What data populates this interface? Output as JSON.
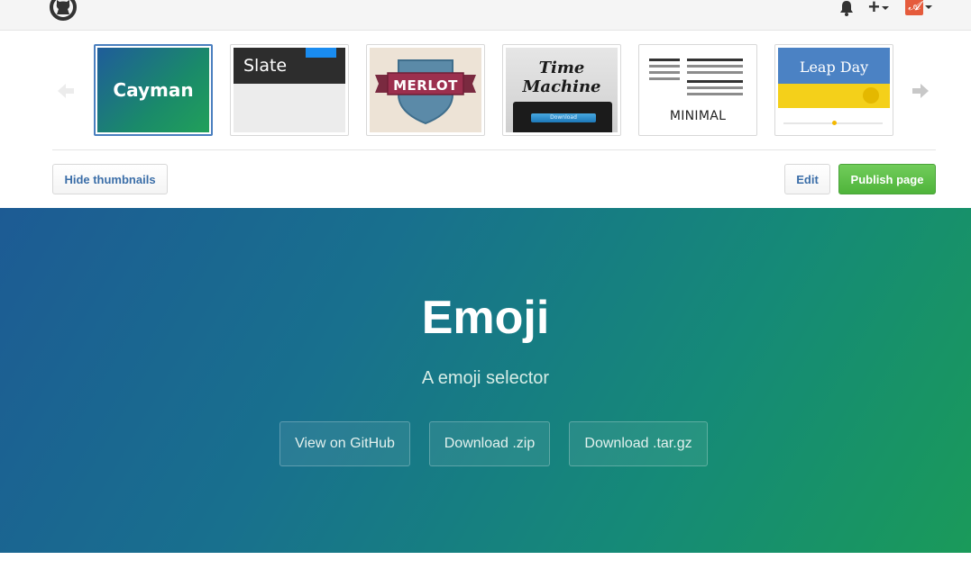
{
  "header": {
    "logo_icon": "github-octocat-icon",
    "notifications_icon": "bell-icon",
    "new_icon": "plus-icon",
    "plus_symbol": "+",
    "avatar_letter": "𝓐"
  },
  "themes": {
    "items": [
      {
        "label": "Cayman",
        "selected": true
      },
      {
        "label": "Slate",
        "selected": false
      },
      {
        "label": "MERLOT",
        "selected": false
      },
      {
        "label": "Time Machine",
        "line1": "Time",
        "line2": "Machine",
        "button": "Download",
        "selected": false
      },
      {
        "label": "MINIMAL",
        "selected": false
      },
      {
        "label": "Leap Day",
        "selected": false
      }
    ],
    "prev_icon": "arrow-left-icon",
    "next_icon": "arrow-right-icon"
  },
  "actions": {
    "hide_thumbnails": "Hide thumbnails",
    "edit": "Edit",
    "publish": "Publish page"
  },
  "colors": {
    "publish_green": "#5cbf47",
    "link_blue": "#3b6ea8",
    "hero_start": "#1d5b94",
    "hero_end": "#1a9a5a"
  },
  "hero": {
    "title": "Emoji",
    "tagline": "A emoji selector",
    "buttons": [
      "View on GitHub",
      "Download .zip",
      "Download .tar.gz"
    ]
  }
}
